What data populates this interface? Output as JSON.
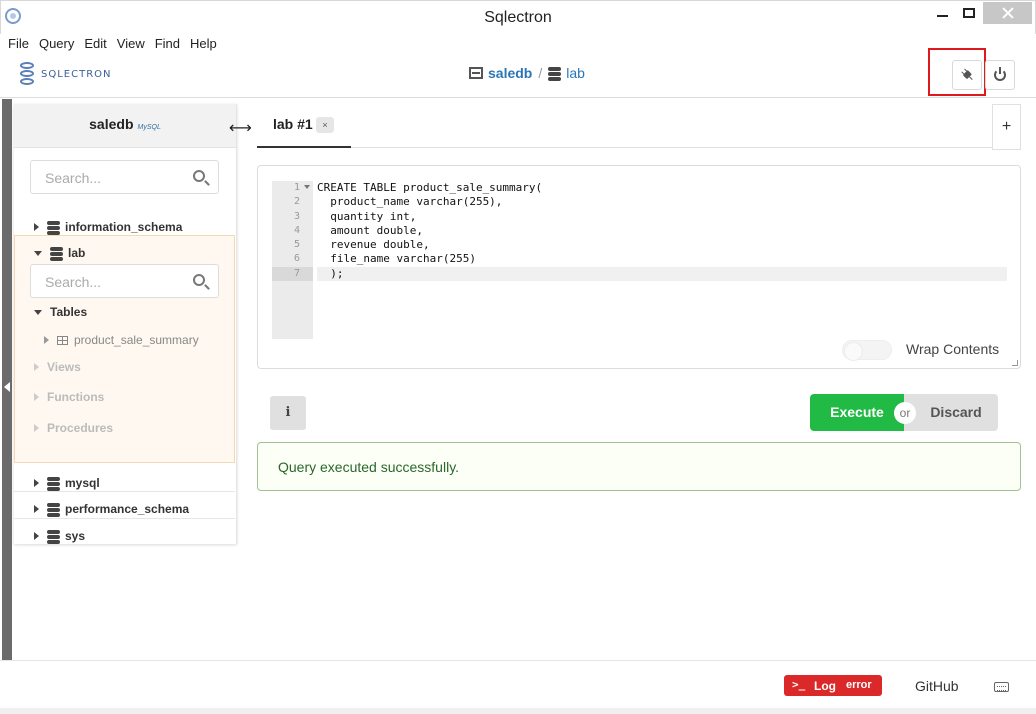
{
  "window": {
    "title": "Sqlectron"
  },
  "menu": [
    "File",
    "Query",
    "Edit",
    "View",
    "Find",
    "Help"
  ],
  "header": {
    "logo_text": "SQLECTRON",
    "server": "saledb",
    "separator": "/",
    "database": "lab"
  },
  "sidebar": {
    "server_name": "saledb",
    "server_type_badge": "MySQL",
    "search_placeholder": "Search...",
    "databases": [
      {
        "name": "information_schema",
        "expanded": false
      },
      {
        "name": "lab",
        "expanded": true
      },
      {
        "name": "mysql",
        "expanded": false
      },
      {
        "name": "performance_schema",
        "expanded": false
      },
      {
        "name": "sys",
        "expanded": false
      }
    ],
    "db_search_placeholder": "Search...",
    "groups": {
      "tables": "Tables",
      "views": "Views",
      "functions": "Functions",
      "procedures": "Procedures"
    },
    "tables": [
      "product_sale_summary"
    ]
  },
  "tabs": [
    {
      "label": "lab #1",
      "close": "×",
      "active": true
    }
  ],
  "add_tab_label": "+",
  "editor": {
    "line_numbers": [
      "1",
      "2",
      "3",
      "4",
      "5",
      "6",
      "7"
    ],
    "lines": [
      "CREATE TABLE product_sale_summary(",
      "  product_name varchar(255),",
      "  quantity int,",
      "  amount double,",
      "  revenue double,",
      "  file_name varchar(255)",
      "  );"
    ],
    "wrap_label": "Wrap Contents",
    "wrap_enabled": false
  },
  "actions": {
    "info_label": "i",
    "execute_label": "Execute",
    "or_label": "or",
    "discard_label": "Discard"
  },
  "message": {
    "text": "Query executed successfully.",
    "type": "success"
  },
  "footer": {
    "log_prompt": ">_",
    "log_label": "Log",
    "log_status": "error",
    "github_label": "GitHub"
  },
  "colors": {
    "execute": "#21ba45",
    "log_error": "#db2828",
    "link": "#2b77b6",
    "success_text": "#2c662d",
    "highlight_box": "#e0191d"
  }
}
